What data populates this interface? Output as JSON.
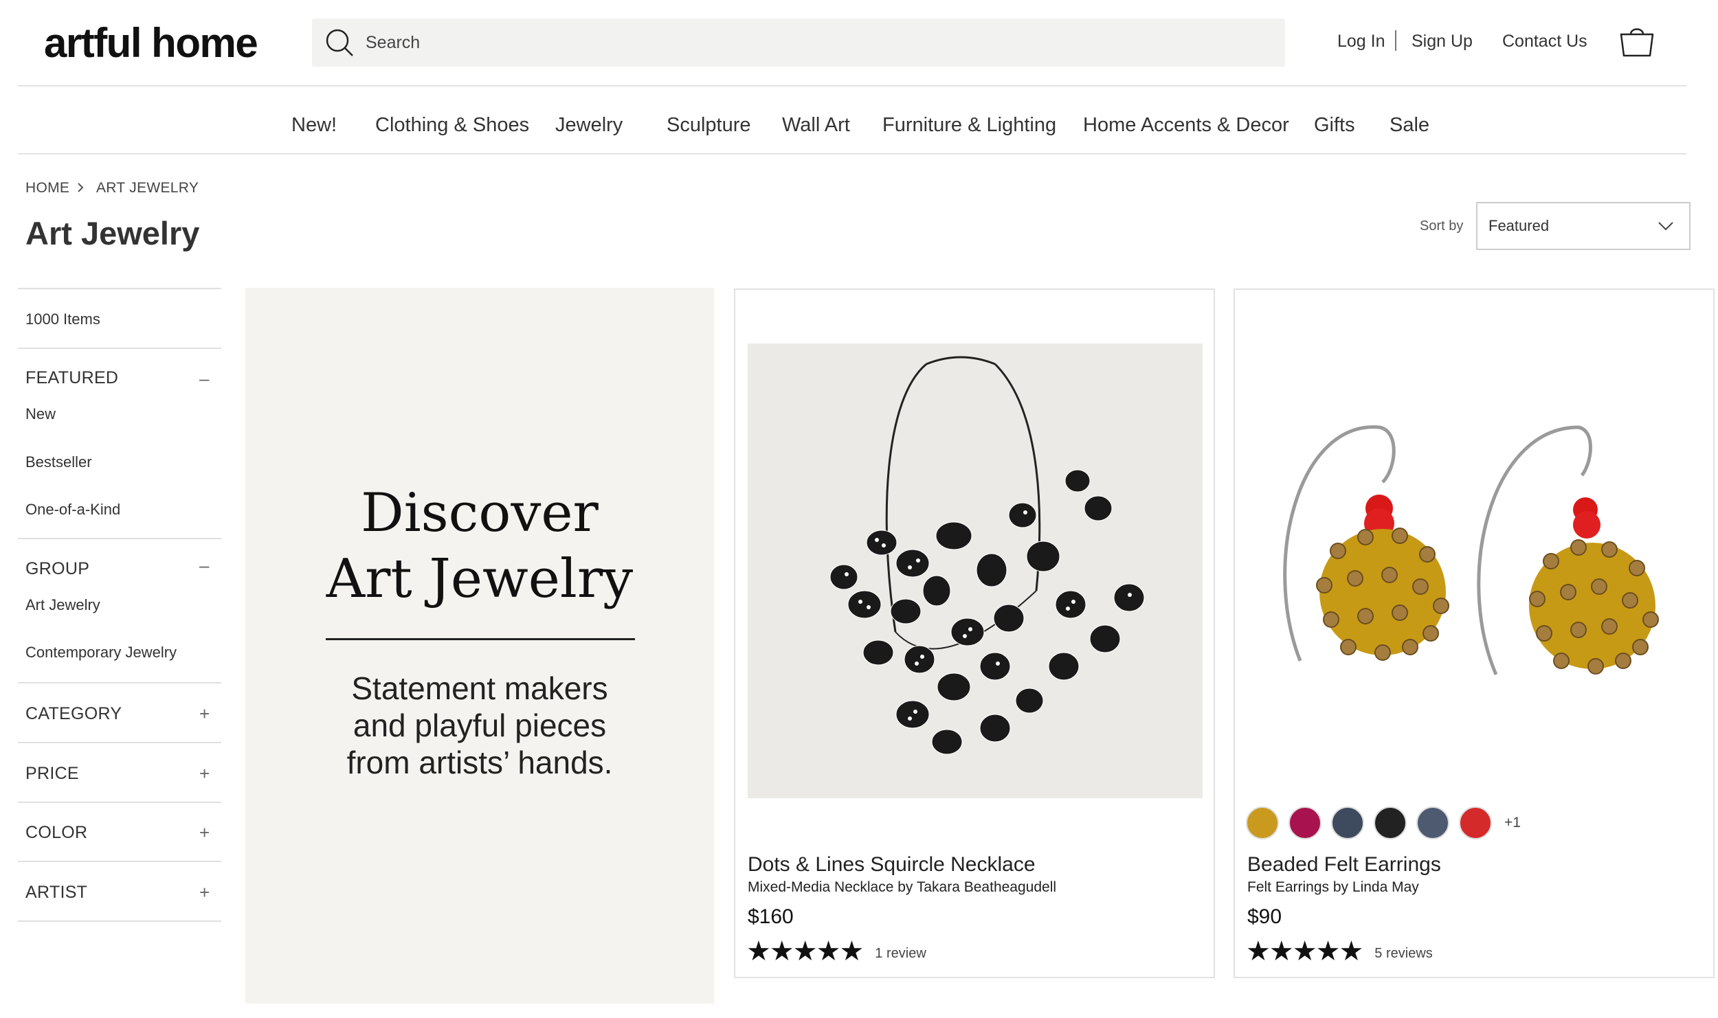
{
  "header": {
    "logo": "artful home",
    "search_placeholder": "Search",
    "login": "Log In",
    "signup": "Sign Up",
    "contact": "Contact Us"
  },
  "nav": [
    "New!",
    "Clothing & Shoes",
    "Jewelry",
    "Sculpture",
    "Wall Art",
    "Furniture & Lighting",
    "Home Accents & Decor",
    "Gifts",
    "Sale"
  ],
  "breadcrumb": {
    "home": "HOME",
    "current": "ART JEWELRY"
  },
  "page_title": "Art Jewelry",
  "sort": {
    "label": "Sort by",
    "selected": "Featured"
  },
  "sidebar": {
    "count": "1000 Items",
    "featured": {
      "title": "FEATURED",
      "toggle": "–",
      "options": [
        "New",
        "Bestseller",
        "One-of-a-Kind"
      ]
    },
    "group": {
      "title": "GROUP",
      "toggle": "–",
      "options": [
        "Art Jewelry",
        "Contemporary Jewelry"
      ]
    },
    "category": {
      "title": "CATEGORY",
      "toggle": "+"
    },
    "price": {
      "title": "PRICE",
      "toggle": "+"
    },
    "color": {
      "title": "COLOR",
      "toggle": "+"
    },
    "artist": {
      "title": "ARTIST",
      "toggle": "+"
    }
  },
  "promo": {
    "title_line1": "Discover",
    "title_line2": "Art Jewelry",
    "sub_line1": "Statement makers",
    "sub_line2": "and playful pieces",
    "sub_line3": "from artists’ hands."
  },
  "products": [
    {
      "name": "Dots & Lines Squircle Necklace",
      "subtitle": "Mixed-Media Necklace by Takara Beatheagudell",
      "price": "$160",
      "stars": "★★★★★",
      "reviews": "1 review"
    },
    {
      "name": "Beaded Felt Earrings",
      "subtitle": "Felt Earrings by Linda May",
      "price": "$90",
      "stars": "★★★★★",
      "reviews": "5 reviews",
      "swatches": [
        "#c99a1e",
        "#a8124e",
        "#3e4a5e",
        "#222222",
        "#4d5a70",
        "#d42a2a"
      ],
      "swatches_more": "+1"
    }
  ]
}
